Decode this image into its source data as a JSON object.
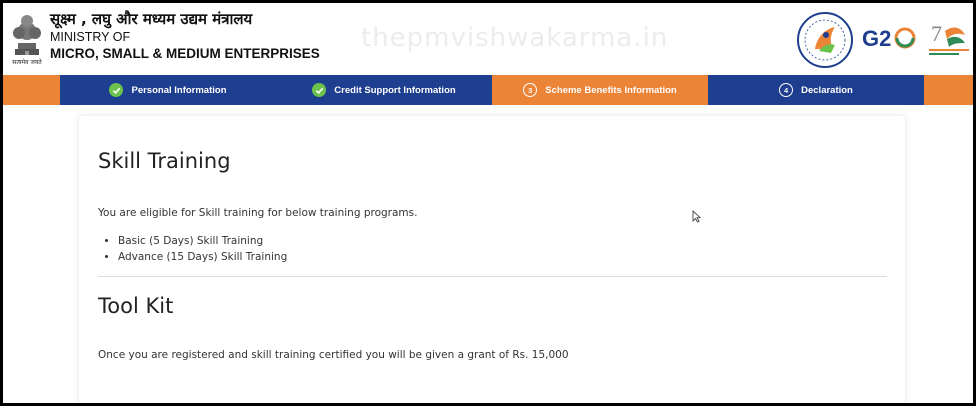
{
  "header": {
    "ministry_hindi": "सूक्ष्म , लघु और मध्यम उद्यम मंत्रालय",
    "ministry_of": "MINISTRY OF",
    "ministry_name": "MICRO, SMALL & MEDIUM ENTERPRISES",
    "emblem_caption": "सत्यमेव जयते",
    "watermark": "thepmvishwakarma.in",
    "icons": [
      "national-emblem-icon",
      "pm-vishwakarma-logo-icon",
      "g20-logo-icon",
      "azadi-ka-amrit-mahotsav-logo-icon"
    ],
    "colors": {
      "orange": "#ec8437",
      "navy": "#1e3f8f",
      "check_green": "#6cc24a"
    }
  },
  "steps": [
    {
      "label": "Personal Information",
      "state": "completed"
    },
    {
      "label": "Credit Support Information",
      "state": "completed"
    },
    {
      "label": "Scheme Benefits Information",
      "number": "3",
      "state": "active"
    },
    {
      "label": "Declaration",
      "number": "4",
      "state": "pending"
    }
  ],
  "skill_training": {
    "title": "Skill Training",
    "description": "You are eligible for Skill training for below training programs.",
    "programs": [
      "Basic (5 Days) Skill Training",
      "Advance (15 Days) Skill Training"
    ]
  },
  "tool_kit": {
    "title": "Tool Kit",
    "description": "Once you are registered and skill training certified you will be given a grant of Rs. 15,000"
  }
}
